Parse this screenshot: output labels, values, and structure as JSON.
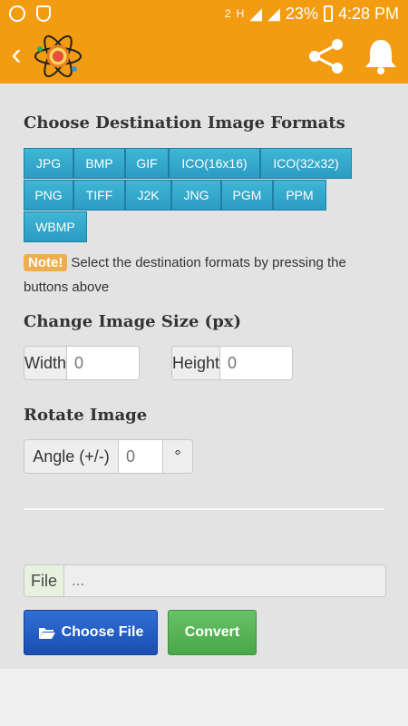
{
  "status_bar": {
    "battery": "23%",
    "time": "4:28 PM",
    "sim_label": "2",
    "network_label": "H"
  },
  "app_bar": {
    "back_icon": "chevron-left-icon",
    "logo_icon": "atom-logo-icon",
    "share_icon": "share-icon",
    "bell_icon": "bell-icon",
    "color": "#f39c12"
  },
  "formats": {
    "heading": "Choose Destination Image Formats",
    "buttons": [
      "JPG",
      "BMP",
      "GIF",
      "ICO(16x16)",
      "ICO(32x32)",
      "PNG",
      "TIFF",
      "J2K",
      "JNG",
      "PGM",
      "PPM",
      "WBMP"
    ]
  },
  "note": {
    "badge": "Note!",
    "text": "Select the destination formats by pressing the buttons above"
  },
  "size": {
    "heading": "Change Image Size (px)",
    "width_label": "Width",
    "width_placeholder": "0",
    "height_label": "Height",
    "height_placeholder": "0"
  },
  "rotate": {
    "heading": "Rotate Image",
    "angle_label": "Angle (+/-)",
    "angle_placeholder": "0",
    "degree_symbol": "°"
  },
  "file": {
    "label": "File",
    "placeholder": "...",
    "choose_label": "Choose File",
    "convert_label": "Convert"
  }
}
